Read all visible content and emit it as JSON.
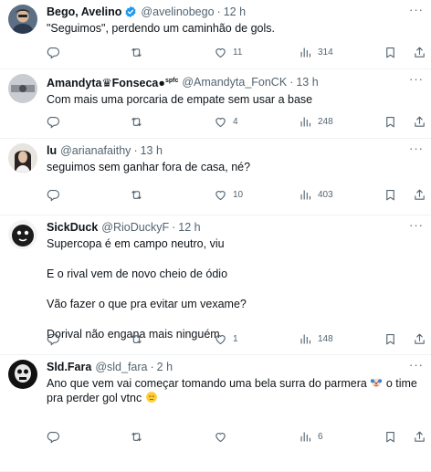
{
  "tweets": [
    {
      "name": "Bego, Avelino",
      "handle": "@avelinobego",
      "time": "12 h",
      "text": [
        "\"Seguimos\", perdendo um caminhão de gols."
      ],
      "replies": "",
      "retweets": "",
      "likes": "11",
      "views": "314"
    },
    {
      "name_prefix": "Amandyta",
      "name_suffix": "Fonseca",
      "name_sup": "spfc",
      "handle": "@Amandyta_FonCK",
      "time": "13 h",
      "text": [
        "Com mais uma porcaria de empate sem usar a base"
      ],
      "replies": "",
      "retweets": "",
      "likes": "4",
      "views": "248"
    },
    {
      "name": "lu",
      "handle": "@arianafaithy",
      "time": "13 h",
      "text": [
        "seguimos sem ganhar fora de casa, né?"
      ],
      "replies": "",
      "retweets": "",
      "likes": "10",
      "views": "403"
    },
    {
      "name": "SickDuck",
      "handle": "@RioDuckyF",
      "time": "12 h",
      "text": [
        "Supercopa é em campo neutro, viu",
        "E o rival vem de novo cheio de ódio",
        "Vão fazer o que pra evitar um vexame?",
        "Dorival não engana mais ninguém"
      ],
      "replies": "",
      "retweets": "",
      "likes": "1",
      "views": "148"
    },
    {
      "name": "Sld.Fara",
      "handle": "@sld_fara",
      "time": "2 h",
      "text_a": "Ano que vem vai começar tomando uma bela surra do parmera ",
      "text_b": " o time pra perder gol vtnc ",
      "replies": "",
      "retweets": "",
      "likes": "",
      "views": "6"
    }
  ],
  "icons": {
    "more": "more-icon",
    "reply": "reply-icon",
    "retweet": "retweet-icon",
    "like": "heart-icon",
    "views": "views-icon",
    "bookmark": "bookmark-icon",
    "share": "share-icon",
    "verified": "verified-badge-icon"
  },
  "colors": {
    "text": "#0f1419",
    "muted": "#536471",
    "verified": "#1d9bf0",
    "divider": "#eff3f4"
  }
}
